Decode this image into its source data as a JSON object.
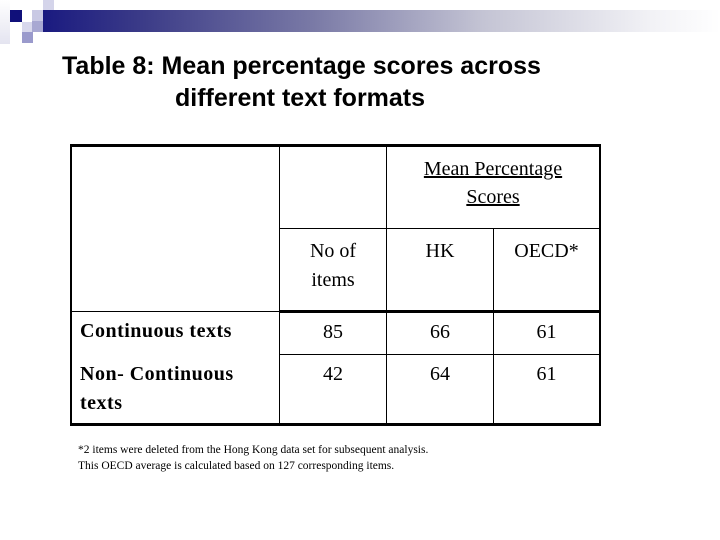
{
  "slide": {
    "title_line1": "Table 8: Mean percentage scores across",
    "title_line2": "different text formats",
    "accent_color": "#1a1a80"
  },
  "table": {
    "group_header": {
      "line1": "Mean Percentage",
      "line2": "Scores"
    },
    "column_headers": {
      "items_line1": "No of",
      "items_line2": "items",
      "hk": "HK",
      "oecd": "OECD*"
    },
    "rows": [
      {
        "label_line1": "Continuous texts",
        "label_line2": "",
        "items": "85",
        "hk": "66",
        "oecd": "61"
      },
      {
        "label_line1": "Non- Continuous",
        "label_line2": "texts",
        "items": "42",
        "hk": "64",
        "oecd": "61"
      }
    ]
  },
  "footnote": {
    "line1": "*2 items were deleted from the Hong Kong data set for subsequent analysis.",
    "line2": "This OECD average is calculated based on 127 corresponding items."
  }
}
